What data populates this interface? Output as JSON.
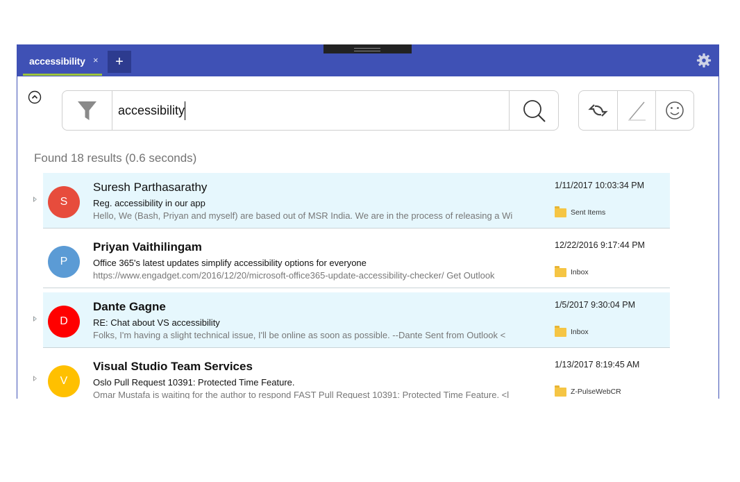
{
  "tabs": {
    "active_label": "accessibility",
    "close_glyph": "×",
    "new_tab_glyph": "+"
  },
  "icons": {
    "settings": "gear-icon",
    "collapse": "chevron-up-icon",
    "filter": "filter-icon",
    "search": "search-icon",
    "sync": "sync-icon",
    "compose": "pen-icon",
    "feedback": "smiley-icon"
  },
  "search": {
    "value": "accessibility"
  },
  "results": {
    "summary": "Found 18 results (0.6 seconds)",
    "items": [
      {
        "sender": "Suresh Parthasarathy",
        "initial": "S",
        "avatar_color": "#e74c3c",
        "subject": "Reg. accessibility in our app",
        "preview": "Hello, We (Bash, Priyan and myself) are based out of MSR India. We are in the process of releasing a Wi",
        "date": "1/11/2017 10:03:34 PM",
        "folder": "Sent Items"
      },
      {
        "sender": "Priyan Vaithilingam",
        "initial": "P",
        "avatar_color": "#5b9bd5",
        "subject": "Office 365's latest updates simplify accessibility options for everyone",
        "preview": "https://www.engadget.com/2016/12/20/microsoft-office365-update-accessibility-checker/ Get Outlook",
        "date": "12/22/2016 9:17:44 PM",
        "folder": "Inbox"
      },
      {
        "sender": "Dante Gagne",
        "initial": "D",
        "avatar_color": "#ff0000",
        "subject": "RE: Chat about VS accessibility",
        "preview": "Folks, I'm having a slight technical issue, I'll be online as soon as possible. --Dante Sent from Outlook <",
        "date": "1/5/2017 9:30:04 PM",
        "folder": "Inbox"
      },
      {
        "sender": "Visual Studio Team Services",
        "initial": "V",
        "avatar_color": "#ffc000",
        "subject": "Oslo Pull Request 10391: Protected Time Feature.",
        "preview": "Omar Mustafa is waiting for the author to respond FAST Pull Request 10391: Protected Time Feature. <l",
        "date": "1/13/2017 8:19:45 AM",
        "folder": "Z-PulseWebCR"
      }
    ]
  },
  "colors": {
    "titlebar": "#3f51b5",
    "tab_underline": "#9ec53a",
    "row_highlight": "#e6f7fd"
  }
}
